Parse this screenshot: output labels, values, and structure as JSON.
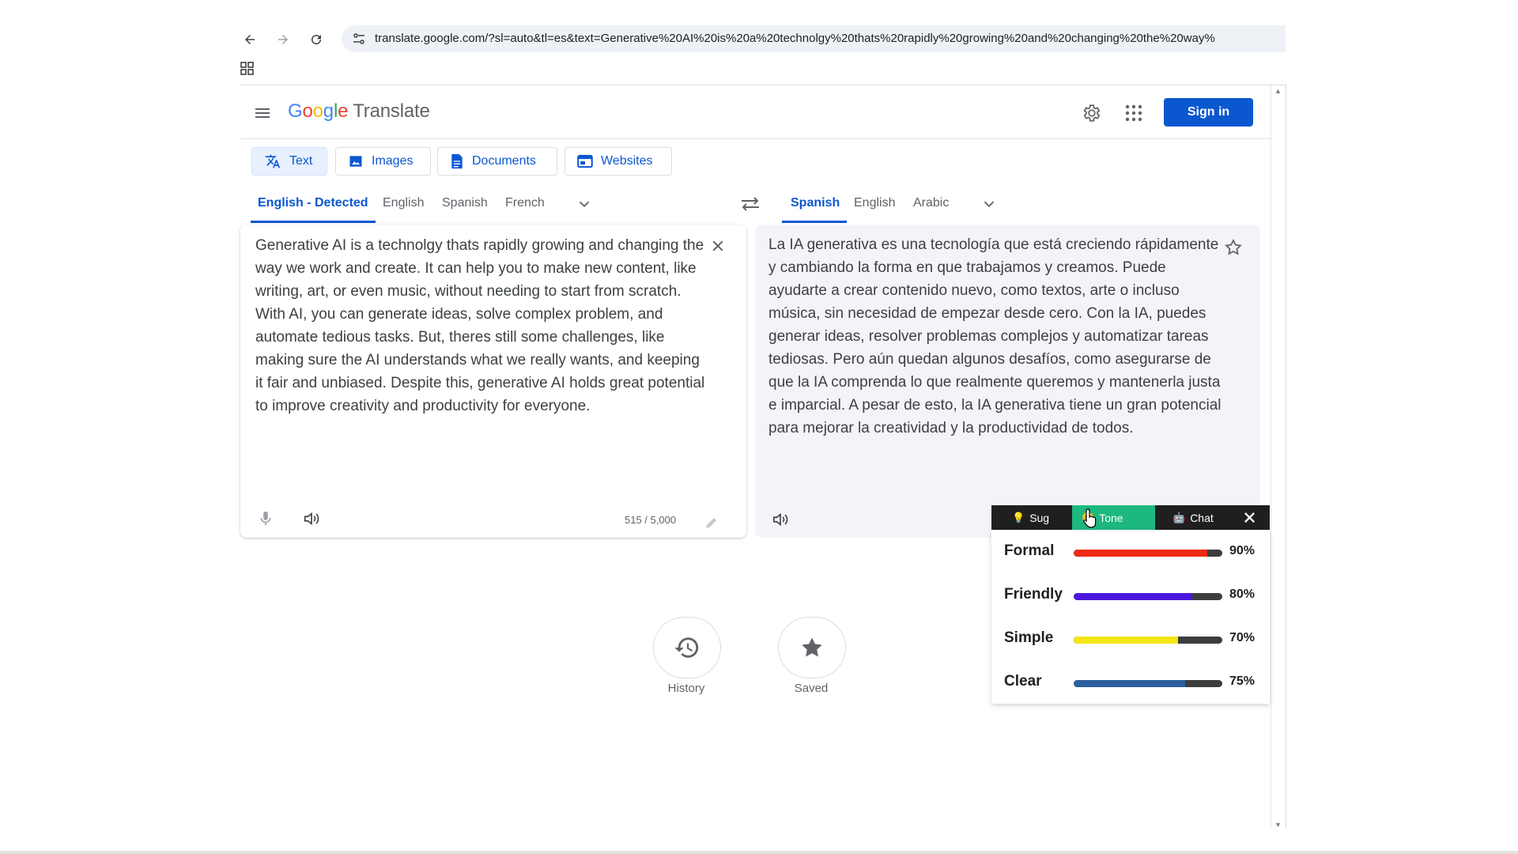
{
  "browser": {
    "url": "translate.google.com/?sl=auto&tl=es&text=Generative%20AI%20is%20a%20technolgy%20thats%20rapidly%20growing%20and%20changing%20the%20way%"
  },
  "header": {
    "logo_google": [
      "G",
      "o",
      "o",
      "g",
      "l",
      "e"
    ],
    "logo_colors": [
      "#4285f4",
      "#ea4335",
      "#fbbc05",
      "#4285f4",
      "#34a853",
      "#ea4335"
    ],
    "logo_translate": "Translate",
    "signin_label": "Sign in"
  },
  "modes": [
    {
      "label": "Text",
      "icon": "translate-icon",
      "active": true
    },
    {
      "label": "Images",
      "icon": "image-icon",
      "active": false
    },
    {
      "label": "Documents",
      "icon": "document-icon",
      "active": false
    },
    {
      "label": "Websites",
      "icon": "website-icon",
      "active": false
    }
  ],
  "source_langs": [
    "English - Detected",
    "English",
    "Spanish",
    "French"
  ],
  "target_langs": [
    "Spanish",
    "English",
    "Arabic"
  ],
  "source_text": "Generative AI is a technolgy thats rapidly growing and changing the way we work and create. It can help you to make new content, like writing, art, or even music, without needing to start from scratch. With AI, you can generate ideas, solve complex problem, and automate tedious tasks. But, theres still some challenges, like making sure the AI understands what we really wants, and keeping it fair and unbiased. Despite this, generative AI holds great potential to improve creativity and productivity for everyone.",
  "target_text": "La IA generativa es una tecnología que está creciendo rápidamente y cambiando la forma en que trabajamos y creamos. Puede ayudarte a crear contenido nuevo, como textos, arte o incluso música, sin necesidad de empezar desde cero. Con la IA, puedes generar ideas, resolver problemas complejos y automatizar tareas tediosas. Pero aún quedan algunos desafíos, como asegurarse de que la IA comprenda lo que realmente queremos y mantenerla justa e imparcial. A pesar de esto, la IA generativa tiene un gran potencial para mejorar la creatividad y la productividad de todos.",
  "char_count": "515 / 5,000",
  "history_label": "History",
  "saved_label": "Saved",
  "extension": {
    "tabs": [
      "Sug",
      "Tone",
      "Chat"
    ],
    "active_tab": "Tone",
    "tones": [
      {
        "name": "Formal",
        "value": 0.9,
        "label": "90%",
        "color": "#ee2b16"
      },
      {
        "name": "Friendly",
        "value": 0.8,
        "label": "80%",
        "color": "#4b16dc"
      },
      {
        "name": "Simple",
        "value": 0.7,
        "label": "70%",
        "color": "#f2e613"
      },
      {
        "name": "Clear",
        "value": 0.75,
        "label": "75%",
        "color": "#2c5fa0"
      }
    ]
  },
  "colors": {
    "accent": "#0b57d0",
    "tone_tab_active": "#1db87f"
  }
}
